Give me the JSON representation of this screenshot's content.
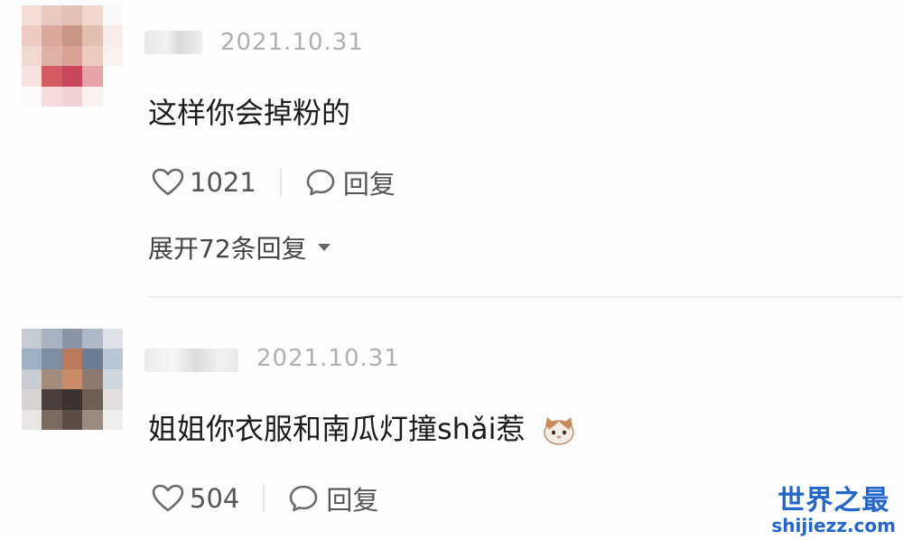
{
  "comments": [
    {
      "timestamp": "2021.10.31",
      "text": "这样你会掉粉的",
      "like_count": "1021",
      "reply_label": "回复",
      "expand_label": "展开72条回复"
    },
    {
      "timestamp": "2021.10.31",
      "text": "姐姐你衣服和南瓜灯撞shǎi惹",
      "like_count": "504",
      "reply_label": "回复"
    }
  ],
  "watermark": {
    "title": "世界之最",
    "url": "shijiezz.com"
  },
  "icons": [
    "heart-icon",
    "reply-bubble-icon",
    "caret-down-icon",
    "cat-emoji-icon"
  ]
}
